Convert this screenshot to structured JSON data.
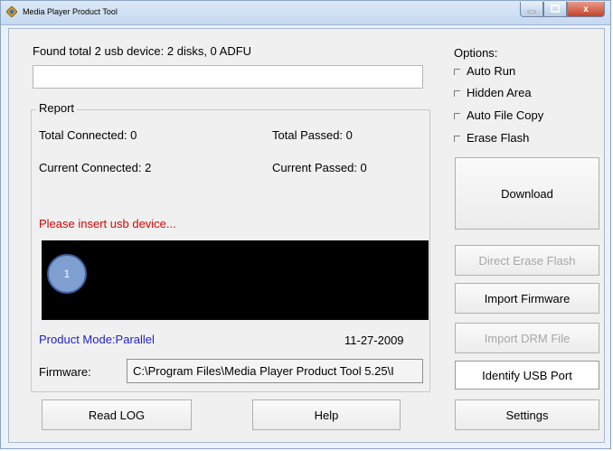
{
  "window": {
    "title": "Media Player Product Tool",
    "caption_close": "x"
  },
  "device_summary": "Found total 2 usb device: 2 disks, 0 ADFU",
  "status_field_value": "",
  "report": {
    "title": "Report",
    "total_connected": "Total Connected: 0",
    "total_passed": "Total Passed: 0",
    "current_connected": "Current Connected: 2",
    "current_passed": "Current Passed: 0",
    "message": "Please insert usb device...",
    "ports": [
      {
        "label": "1",
        "color": "#7f9fd0"
      }
    ],
    "product_mode": "Product Mode:Parallel",
    "date": "11-27-2009",
    "firmware_label": "Firmware:",
    "firmware_path": "C:\\Program Files\\Media Player Product Tool 5.25\\I"
  },
  "options": {
    "title": "Options:",
    "items": [
      {
        "label": "Auto Run",
        "checked": false
      },
      {
        "label": "Hidden Area",
        "checked": false
      },
      {
        "label": "Auto File Copy",
        "checked": false
      },
      {
        "label": "Erase Flash",
        "checked": false
      }
    ]
  },
  "buttons": {
    "download": "Download",
    "direct_erase_flash": "Direct Erase Flash",
    "import_firmware": "Import Firmware",
    "import_drm_file": "Import DRM File",
    "identify_usb_port": "Identify USB Port",
    "settings": "Settings",
    "read_log": "Read LOG",
    "help": "Help"
  },
  "colors": {
    "warning": "#e00000",
    "mode_text": "#1f1fcf",
    "disabled_text": "#a7a7a7",
    "port_circle": "#7f9fd0"
  }
}
